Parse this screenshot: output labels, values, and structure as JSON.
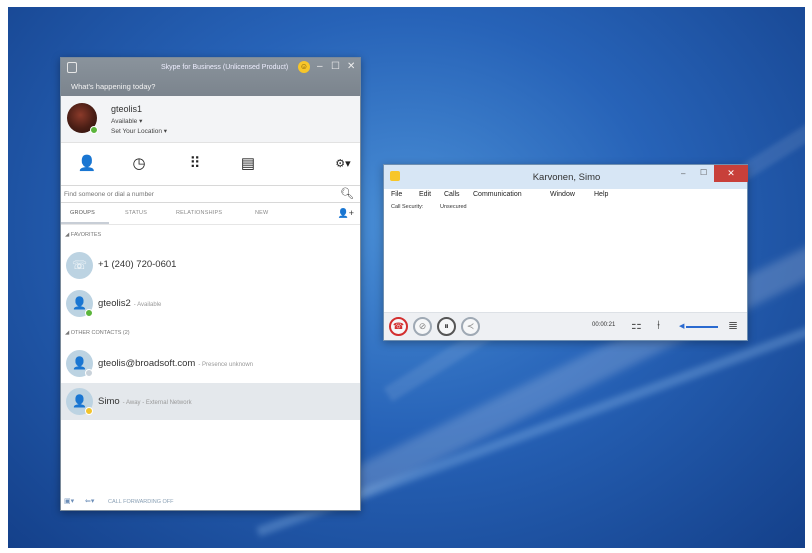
{
  "skype": {
    "title": "Skype for Business (Unlicensed Product)",
    "whats_happening": "What's happening today?",
    "window_controls": {
      "minimize": "–",
      "maximize": "☐",
      "close": "✕"
    },
    "profile": {
      "username": "gteolis1",
      "availability": "Available ▾",
      "location": "Set Your Location ▾"
    },
    "tabs": [
      {
        "icon": "contacts-icon",
        "glyph": "👤"
      },
      {
        "icon": "conversations-icon",
        "glyph": "◷"
      },
      {
        "icon": "dialpad-icon",
        "glyph": "⠿"
      },
      {
        "icon": "meetings-icon",
        "glyph": "▤"
      }
    ],
    "settings_glyph": "⚙▾",
    "search_placeholder": "Find someone or dial a number",
    "subtabs": [
      "GROUPS",
      "STATUS",
      "RELATIONSHIPS",
      "NEW"
    ],
    "groups": [
      {
        "label": "◢ FAVORITES",
        "contacts": [
          {
            "name": "+1 (240) 720-0601",
            "status": ""
          },
          {
            "name": "gteolis2",
            "status": "- Available"
          }
        ]
      },
      {
        "label": "◢ OTHER CONTACTS (2)",
        "contacts": [
          {
            "name": "gteolis@broadsoft.com",
            "status": "- Presence unknown"
          },
          {
            "name": "Simo",
            "status": "- Away - External Network"
          }
        ]
      }
    ],
    "footer": {
      "call_forwarding": "CALL FORWARDING OFF"
    }
  },
  "call_window": {
    "title": "Karvonen, Simo",
    "menu": [
      "File",
      "Edit",
      "Calls",
      "Communication",
      "Window",
      "Help"
    ],
    "call_security_label": "Call Security:",
    "call_security_value": "Unsecured",
    "timer": "00:00:21"
  },
  "colors": {
    "desktop_blue": "#2763b8",
    "titlebar_gray": "#7b848d",
    "hangup_red": "#d32f2f",
    "presence_available": "#5bb53b",
    "presence_away": "#f2c32c",
    "close_red": "#c8403a"
  }
}
